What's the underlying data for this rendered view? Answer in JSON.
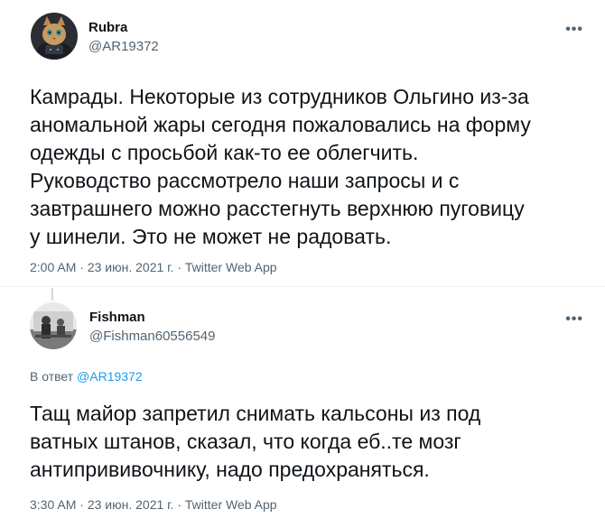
{
  "tweets": [
    {
      "display_name": "Rubra",
      "handle": "@AR19372",
      "more_icon": "•••",
      "text": "Камрады. Некоторые из сотрудников Ольгино из-за\nаномальной жары сегодня пожаловались на форму\nодежды с просьбой как-то ее облегчить.\nРуководство рассмотрело наши запросы и с\nзавтрашнего можно расстегнуть верхнюю пуговицу\nу шинели. Это не может не радовать.",
      "time": "2:00 AM",
      "date": "23 июн. 2021 г.",
      "source": "Twitter Web App",
      "separator": "·"
    },
    {
      "display_name": "Fishman",
      "handle": "@Fishman60556549",
      "more_icon": "•••",
      "reply_prefix": "В ответ",
      "reply_mention": "@AR19372",
      "text": "Тащ майор запретил снимать кальсоны из под\nватных штанов, сказал, что когда еб..те мозг\nантипрививочнику, надо предохраняться.",
      "time": "3:30 AM",
      "date": "23 июн. 2021 г.",
      "source": "Twitter Web App",
      "separator": "·"
    }
  ]
}
